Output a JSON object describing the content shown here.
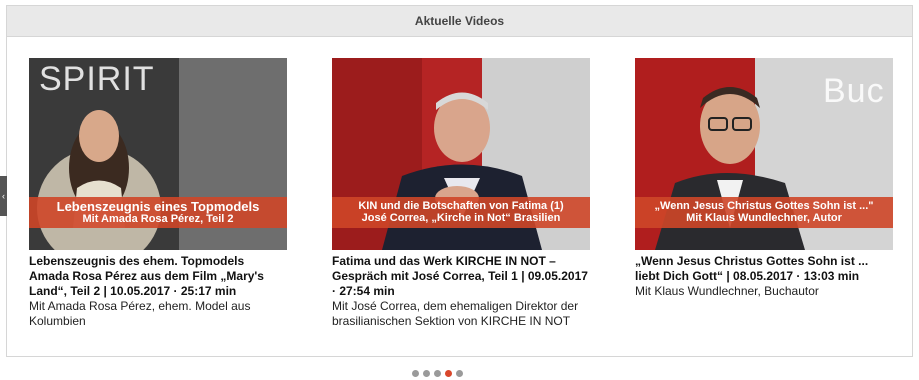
{
  "header": {
    "title": "Aktuelle Videos"
  },
  "videos": [
    {
      "watermark": "SPIRIT",
      "banner_line1": "Lebenszeugnis eines Topmodels",
      "banner_line2": "Mit Amada Rosa Pérez, Teil 2",
      "title": "Lebenszeugnis des ehem. Topmodels Amada Rosa Pérez aus dem Film „Mary's Land“, Teil 2 | 10.05.2017 · 25:17 min",
      "description": "Mit Amada Rosa Pérez, ehem. Model aus Kolumbien"
    },
    {
      "watermark": "",
      "banner_line1": "KIN und die Botschaften von Fatima (1)",
      "banner_line2": "José Correa, „Kirche in Not“ Brasilien",
      "title": "Fatima und das Werk KIRCHE IN NOT – Gespräch mit José Correa, Teil 1 | 09.05.2017 · 27:54 min",
      "description": "Mit José Correa, dem ehemaligen Direktor der brasilianischen Sektion von KIRCHE IN NOT"
    },
    {
      "watermark": "Buc",
      "banner_line1": "„Wenn Jesus Christus Gottes Sohn ist ...\"",
      "banner_line2": "Mit Klaus Wundlechner, Autor",
      "title": "„Wenn Jesus Christus Gottes Sohn ist ... liebt Dich Gott“ | 08.05.2017 · 13:03 min",
      "description": "Mit Klaus Wundlechner, Buchautor"
    }
  ],
  "pagination": {
    "total": 5,
    "active_index": 3
  },
  "colors": {
    "accent": "#d9472b",
    "banner": "#ce4628",
    "header_bg": "#e9e9e9"
  },
  "icons": {
    "prev": "chevron-left-icon"
  }
}
